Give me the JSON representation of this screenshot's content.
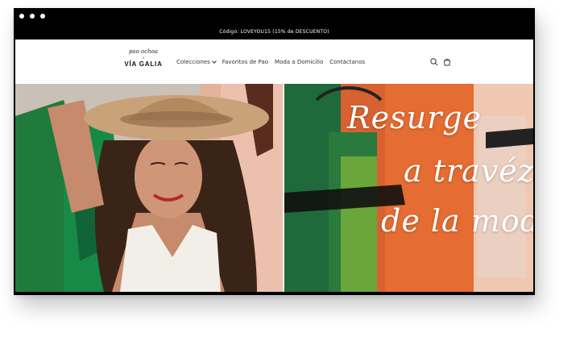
{
  "window": {
    "dots": [
      "window-dot-1",
      "window-dot-2",
      "window-dot-3"
    ]
  },
  "announcement": {
    "text": "Código: LOVEYOU15 (15% de DESCUENTO)"
  },
  "logo": {
    "script": "pao ochoa",
    "x": "×",
    "brand": "VÍA GALIA"
  },
  "nav": {
    "items": [
      {
        "label": "Colecciones",
        "has_dropdown": true
      },
      {
        "label": "Favoritos de Pao",
        "has_dropdown": false
      },
      {
        "label": "Moda a Domicilio",
        "has_dropdown": false
      },
      {
        "label": "Contáctanos",
        "has_dropdown": false
      }
    ]
  },
  "icons": {
    "search": "search-icon",
    "cart": "cart-icon"
  },
  "hero": {
    "lines": [
      "Resurge",
      "a travéz",
      "de la moda"
    ]
  },
  "colors": {
    "bar": "#000000",
    "header_bg": "#ffffff",
    "text": "#333333",
    "hero_text": "#ffffff",
    "accent_orange": "#e06a32",
    "accent_green": "#2a6a3a"
  }
}
